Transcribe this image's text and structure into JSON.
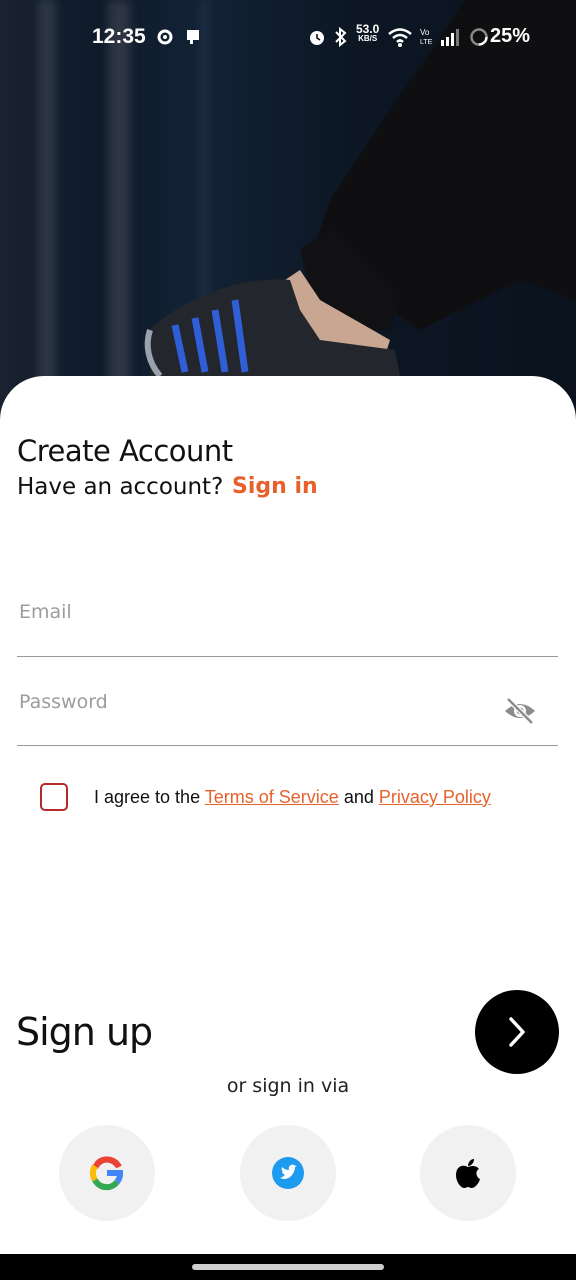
{
  "status_bar": {
    "time": "12:35",
    "network_speed_value": "53.0",
    "network_speed_unit": "KB/S",
    "battery_percent": "25%",
    "icons": [
      "settings-icon",
      "cast-icon",
      "alarm-icon",
      "bluetooth-icon",
      "wifi-icon",
      "volte-icon",
      "signal-icon",
      "battery-icon"
    ]
  },
  "header": {
    "title": "Create Account",
    "have_account_text": "Have an account?",
    "sign_in_link": "Sign in"
  },
  "form": {
    "email_placeholder": "Email",
    "email_value": "",
    "password_placeholder": "Password",
    "password_value": "",
    "password_toggle_icon": "eye-off-icon",
    "agree_prefix": "I agree to the",
    "terms_link": "Terms of Service",
    "agree_and": "and",
    "privacy_link": "Privacy Policy",
    "agree_checked": false
  },
  "actions": {
    "sign_up_label": "Sign up",
    "next_icon": "chevron-right-icon",
    "or_sign_in_via": "or sign in via",
    "social": [
      "google-icon",
      "twitter-icon",
      "apple-icon"
    ]
  },
  "colors": {
    "accent": "#e8612c",
    "checkbox_border": "#b52a2a",
    "twitter": "#1d9bf0"
  }
}
